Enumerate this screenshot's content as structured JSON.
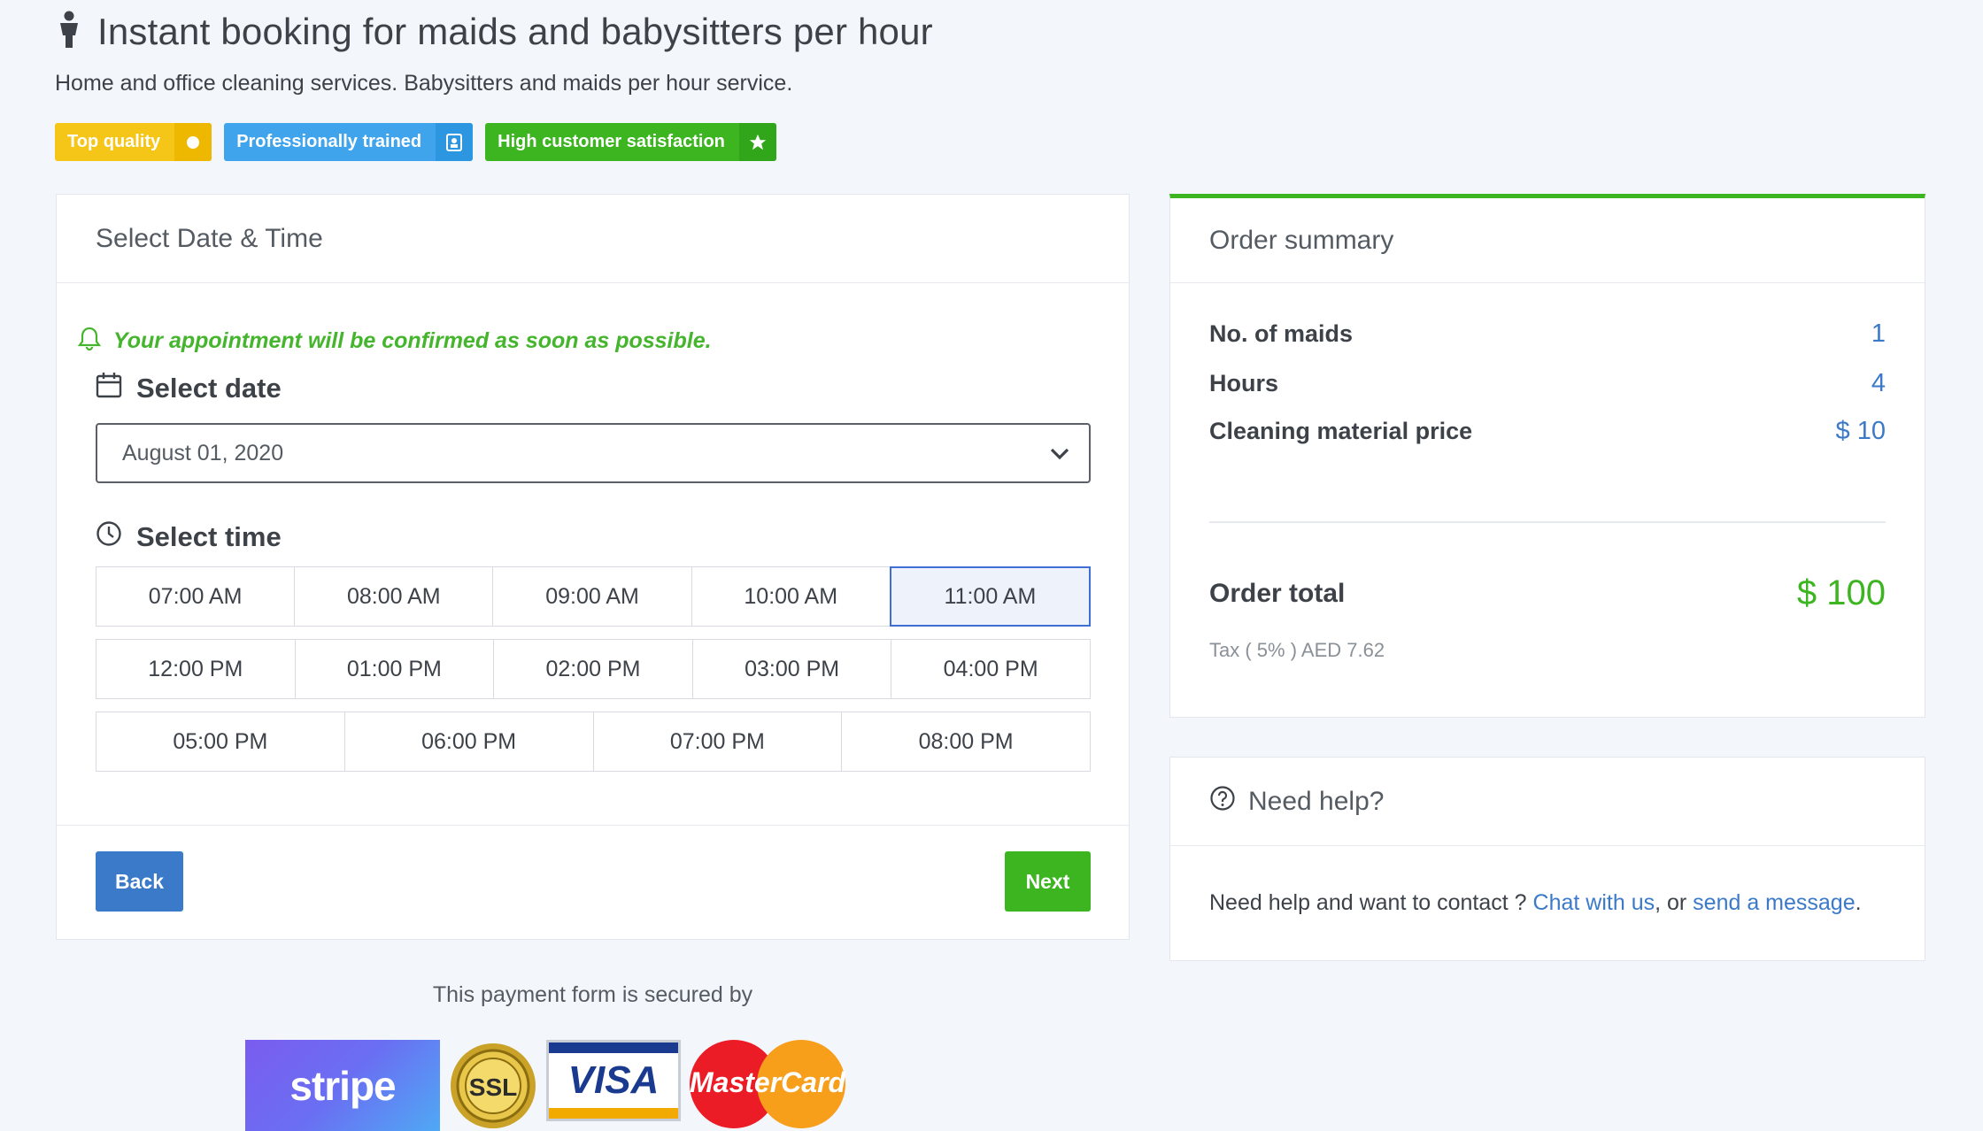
{
  "header": {
    "title": "Instant booking for maids and babysitters per hour",
    "subtitle": "Home and office cleaning services. Babysitters and maids per hour service.",
    "badges": [
      {
        "label": "Top quality",
        "color": "#f5c518",
        "icon": "circle-icon"
      },
      {
        "label": "Professionally trained",
        "color": "#3fa4ec",
        "icon": "id-card-icon"
      },
      {
        "label": "High customer satisfaction",
        "color": "#3cb521",
        "icon": "star-icon"
      }
    ]
  },
  "booking": {
    "card_title": "Select Date & Time",
    "notice": "Your appointment will be confirmed as soon as possible.",
    "date_label": "Select date",
    "date_value": "August 01, 2020",
    "time_label": "Select time",
    "time_rows": [
      [
        "07:00 AM",
        "08:00 AM",
        "09:00 AM",
        "10:00 AM",
        "11:00 AM"
      ],
      [
        "12:00 PM",
        "01:00 PM",
        "02:00 PM",
        "03:00 PM",
        "04:00 PM"
      ],
      [
        "05:00 PM",
        "06:00 PM",
        "07:00 PM",
        "08:00 PM"
      ]
    ],
    "selected_time": "11:00 AM",
    "back_label": "Back",
    "next_label": "Next"
  },
  "summary": {
    "card_title": "Order summary",
    "rows": [
      {
        "label": "No. of maids",
        "value": "1"
      },
      {
        "label": "Hours",
        "value": "4"
      },
      {
        "label": "Cleaning material price",
        "value": "$ 10"
      }
    ],
    "total_label": "Order total",
    "total_value": "$ 100",
    "tax": "Tax ( 5% ) AED 7.62",
    "accent_color": "#3cb521"
  },
  "help": {
    "card_title": "Need help?",
    "text_before": "Need help and want to contact ? ",
    "chat_link": "Chat with us",
    "text_middle": ", or ",
    "message_link": "send a message",
    "text_after": "."
  },
  "payment": {
    "secured_text": "This payment form is secured by",
    "logos": {
      "stripe": "stripe",
      "ssl": "SSL",
      "visa": "VISA",
      "mastercard": "MasterCard"
    }
  }
}
